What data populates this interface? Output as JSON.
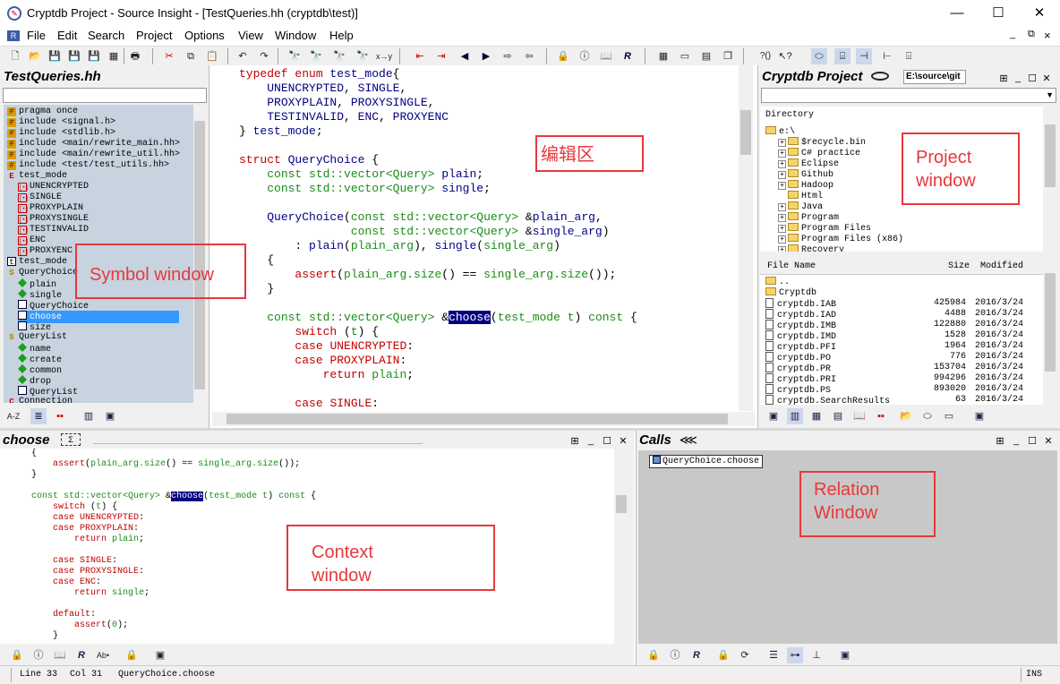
{
  "window": {
    "title": "Cryptdb Project - Source Insight - [TestQueries.hh (cryptdb\\test)]",
    "app_icon": "source-insight-icon",
    "minimize": "—",
    "maximize": "☐",
    "close": "✕"
  },
  "menu": [
    "File",
    "Edit",
    "Search",
    "Project",
    "Options",
    "View",
    "Window",
    "Help"
  ],
  "mdi_controls": [
    "_",
    "⧉",
    "×"
  ],
  "symbol_window": {
    "title": "TestQueries.hh",
    "items": [
      {
        "icon": "include-icon",
        "text": "pragma once"
      },
      {
        "icon": "include-icon",
        "text": "include <signal.h>"
      },
      {
        "icon": "include-icon",
        "text": "include <stdlib.h>"
      },
      {
        "icon": "include-icon",
        "text": "include <main/rewrite_main.hh>"
      },
      {
        "icon": "include-icon",
        "text": "include <main/rewrite_util.hh>"
      },
      {
        "icon": "include-icon",
        "text": "include <test/test_utils.hh>"
      },
      {
        "icon": "enum-icon",
        "text": "test_mode"
      },
      {
        "icon": "constant-icon",
        "text": "UNENCRYPTED"
      },
      {
        "icon": "constant-icon",
        "text": "SINGLE"
      },
      {
        "icon": "constant-icon",
        "text": "PROXYPLAIN"
      },
      {
        "icon": "constant-icon",
        "text": "PROXYSINGLE"
      },
      {
        "icon": "constant-icon",
        "text": "TESTINVALID"
      },
      {
        "icon": "constant-icon",
        "text": "ENC"
      },
      {
        "icon": "constant-icon",
        "text": "PROXYENC"
      },
      {
        "icon": "typedef-icon",
        "text": "test_mode"
      },
      {
        "icon": "struct-icon",
        "text": "QueryChoice"
      },
      {
        "icon": "field-icon",
        "text": "plain"
      },
      {
        "icon": "field-icon",
        "text": "single"
      },
      {
        "icon": "function-icon",
        "text": "QueryChoice"
      },
      {
        "icon": "function-icon",
        "text": "choose"
      },
      {
        "icon": "function-icon",
        "text": "size"
      },
      {
        "icon": "struct-icon",
        "text": "QueryList"
      },
      {
        "icon": "field-icon",
        "text": "name"
      },
      {
        "icon": "field-icon",
        "text": "create"
      },
      {
        "icon": "field-icon",
        "text": "common"
      },
      {
        "icon": "field-icon",
        "text": "drop"
      },
      {
        "icon": "function-icon",
        "text": "QueryList"
      },
      {
        "icon": "class-icon",
        "text": "Connection"
      }
    ],
    "selected_index": 19,
    "bottom_buttons": [
      "A-Z",
      "≣",
      "▪▪",
      "▥",
      "▣"
    ]
  },
  "editor": {
    "lines": [
      [
        [
          "kw",
          "typedef enum "
        ],
        [
          "id",
          "test_mode"
        ],
        [
          "",
          "{"
        ]
      ],
      [
        [
          "",
          "    "
        ],
        [
          "id",
          "UNENCRYPTED"
        ],
        [
          "",
          ", "
        ],
        [
          "id",
          "SINGLE"
        ],
        [
          "",
          ","
        ]
      ],
      [
        [
          "",
          "    "
        ],
        [
          "id",
          "PROXYPLAIN"
        ],
        [
          "",
          ", "
        ],
        [
          "id",
          "PROXYSINGLE"
        ],
        [
          "",
          ","
        ]
      ],
      [
        [
          "",
          "    "
        ],
        [
          "id",
          "TESTINVALID"
        ],
        [
          "",
          ", "
        ],
        [
          "id",
          "ENC"
        ],
        [
          "",
          ", "
        ],
        [
          "id",
          "PROXYENC"
        ]
      ],
      [
        [
          "",
          "} "
        ],
        [
          "id",
          "test_mode"
        ],
        [
          "",
          ";"
        ]
      ],
      [
        [
          "",
          ""
        ]
      ],
      [
        [
          "kw",
          "struct "
        ],
        [
          "id",
          "QueryChoice "
        ],
        [
          "",
          "{"
        ]
      ],
      [
        [
          "",
          "    "
        ],
        [
          "ty",
          "const std::vector<Query> "
        ],
        [
          "id",
          "plain"
        ],
        [
          "",
          ";"
        ]
      ],
      [
        [
          "",
          "    "
        ],
        [
          "ty",
          "const std::vector<Query> "
        ],
        [
          "id",
          "single"
        ],
        [
          "",
          ";"
        ]
      ],
      [
        [
          "",
          ""
        ]
      ],
      [
        [
          "",
          "    "
        ],
        [
          "id",
          "QueryChoice"
        ],
        [
          "",
          "("
        ],
        [
          "ty",
          "const std::vector<Query> "
        ],
        [
          "",
          "&"
        ],
        [
          "id",
          "plain_arg"
        ],
        [
          "",
          ","
        ]
      ],
      [
        [
          "",
          "                "
        ],
        [
          "ty",
          "const std::vector<Query> "
        ],
        [
          "",
          "&"
        ],
        [
          "id",
          "single_arg"
        ],
        [
          "",
          ")"
        ]
      ],
      [
        [
          "",
          "        : "
        ],
        [
          "id",
          "plain"
        ],
        [
          "",
          "("
        ],
        [
          "ty",
          "plain_arg"
        ],
        [
          "",
          "), "
        ],
        [
          "id",
          "single"
        ],
        [
          "",
          "("
        ],
        [
          "ty",
          "single_arg"
        ],
        [
          "",
          ")"
        ]
      ],
      [
        [
          "",
          "    {"
        ]
      ],
      [
        [
          "",
          "        "
        ],
        [
          "kw",
          "assert"
        ],
        [
          "",
          "("
        ],
        [
          "ty",
          "plain_arg.size"
        ],
        [
          "",
          "() == "
        ],
        [
          "ty",
          "single_arg.size"
        ],
        [
          "",
          "());"
        ]
      ],
      [
        [
          "",
          "    }"
        ]
      ],
      [
        [
          "",
          ""
        ]
      ],
      [
        [
          "",
          "    "
        ],
        [
          "ty",
          "const std::vector<Query> "
        ],
        [
          "",
          "&"
        ],
        [
          "hl",
          "choose"
        ],
        [
          "",
          "("
        ],
        [
          "ty",
          "test_mode t"
        ],
        [
          "",
          ") "
        ],
        [
          "ty",
          "const "
        ],
        [
          "",
          "{"
        ]
      ],
      [
        [
          "",
          "        "
        ],
        [
          "kw",
          "switch "
        ],
        [
          "",
          "("
        ],
        [
          "ty",
          "t"
        ],
        [
          "",
          ") {"
        ]
      ],
      [
        [
          "",
          "        "
        ],
        [
          "kw",
          "case "
        ],
        [
          "kw",
          "UNENCRYPTED"
        ],
        [
          "",
          ":"
        ]
      ],
      [
        [
          "",
          "        "
        ],
        [
          "kw",
          "case "
        ],
        [
          "kw",
          "PROXYPLAIN"
        ],
        [
          "",
          ":"
        ]
      ],
      [
        [
          "",
          "            "
        ],
        [
          "kw",
          "return "
        ],
        [
          "ty",
          "plain"
        ],
        [
          "",
          ";"
        ]
      ],
      [
        [
          "",
          ""
        ]
      ],
      [
        [
          "",
          "        "
        ],
        [
          "kw",
          "case "
        ],
        [
          "kw",
          "SINGLE"
        ],
        [
          "",
          ":"
        ]
      ]
    ]
  },
  "project_window": {
    "title": "Cryptdb Project",
    "path": "E:\\source\\git",
    "directory_label": "Directory",
    "root": "e:\\",
    "folders": [
      "$recycle.bin",
      "C# practice",
      "Eclipse",
      "Github",
      "Hadoop",
      "Html",
      "Java",
      "Program",
      "Program Files",
      "Program Files (x86)",
      "Recovery"
    ],
    "file_headers": {
      "name": "File Name",
      "size": "Size",
      "modified": "Modified"
    },
    "files": [
      {
        "name": "..",
        "size": "",
        "modified": "",
        "kind": "folder"
      },
      {
        "name": "Cryptdb",
        "size": "",
        "modified": "",
        "kind": "folder"
      },
      {
        "name": "cryptdb.IAB",
        "size": "425984",
        "modified": "2016/3/24",
        "kind": "file"
      },
      {
        "name": "cryptdb.IAD",
        "size": "4488",
        "modified": "2016/3/24",
        "kind": "file"
      },
      {
        "name": "cryptdb.IMB",
        "size": "122880",
        "modified": "2016/3/24",
        "kind": "file"
      },
      {
        "name": "cryptdb.IMD",
        "size": "1528",
        "modified": "2016/3/24",
        "kind": "file"
      },
      {
        "name": "cryptdb.PFI",
        "size": "1964",
        "modified": "2016/3/24",
        "kind": "file"
      },
      {
        "name": "cryptdb.PO",
        "size": "776",
        "modified": "2016/3/24",
        "kind": "file"
      },
      {
        "name": "cryptdb.PR",
        "size": "153704",
        "modified": "2016/3/24",
        "kind": "file"
      },
      {
        "name": "cryptdb.PRI",
        "size": "994296",
        "modified": "2016/3/24",
        "kind": "file"
      },
      {
        "name": "cryptdb.PS",
        "size": "893020",
        "modified": "2016/3/24",
        "kind": "file"
      },
      {
        "name": "cryptdb.SearchResults",
        "size": "63",
        "modified": "2016/3/24",
        "kind": "file"
      }
    ]
  },
  "context_window": {
    "title": "choose",
    "lines": [
      [
        [
          "",
          "{"
        ]
      ],
      [
        [
          "",
          "    "
        ],
        [
          "kw",
          "assert"
        ],
        [
          "",
          "("
        ],
        [
          "ty",
          "plain_arg.size"
        ],
        [
          "",
          "() == "
        ],
        [
          "ty",
          "single_arg.size"
        ],
        [
          "",
          "());"
        ]
      ],
      [
        [
          "",
          "}"
        ]
      ],
      [
        [
          "",
          ""
        ]
      ],
      [
        [
          "ty",
          "const std::vector<Query> "
        ],
        [
          "",
          "&"
        ],
        [
          "hl",
          "choose"
        ],
        [
          "",
          "("
        ],
        [
          "ty",
          "test_mode t"
        ],
        [
          "",
          ") "
        ],
        [
          "ty",
          "const "
        ],
        [
          "",
          "{"
        ]
      ],
      [
        [
          "",
          "    "
        ],
        [
          "kw",
          "switch "
        ],
        [
          "",
          "("
        ],
        [
          "ty",
          "t"
        ],
        [
          "",
          ") {"
        ]
      ],
      [
        [
          "",
          "    "
        ],
        [
          "kw",
          "case UNENCRYPTED"
        ],
        [
          "",
          ":"
        ]
      ],
      [
        [
          "",
          "    "
        ],
        [
          "kw",
          "case PROXYPLAIN"
        ],
        [
          "",
          ":"
        ]
      ],
      [
        [
          "",
          "        "
        ],
        [
          "kw",
          "return "
        ],
        [
          "ty",
          "plain"
        ],
        [
          "",
          ";"
        ]
      ],
      [
        [
          "",
          ""
        ]
      ],
      [
        [
          "",
          "    "
        ],
        [
          "kw",
          "case SINGLE"
        ],
        [
          "",
          ":"
        ]
      ],
      [
        [
          "",
          "    "
        ],
        [
          "kw",
          "case PROXYSINGLE"
        ],
        [
          "",
          ":"
        ]
      ],
      [
        [
          "",
          "    "
        ],
        [
          "kw",
          "case ENC"
        ],
        [
          "",
          ":"
        ]
      ],
      [
        [
          "",
          "        "
        ],
        [
          "kw",
          "return "
        ],
        [
          "ty",
          "single"
        ],
        [
          "",
          ";"
        ]
      ],
      [
        [
          "",
          ""
        ]
      ],
      [
        [
          "",
          "    "
        ],
        [
          "kw",
          "default"
        ],
        [
          "",
          ":"
        ]
      ],
      [
        [
          "",
          "        "
        ],
        [
          "kw",
          "assert"
        ],
        [
          "",
          "("
        ],
        [
          "ty",
          "0"
        ],
        [
          "",
          ");"
        ]
      ],
      [
        [
          "",
          "    }"
        ]
      ]
    ]
  },
  "relation_window": {
    "title": "Calls",
    "node": "QueryChoice.choose"
  },
  "annotations": {
    "editor": "编辑区",
    "symbol": "Symbol window",
    "project": [
      "Project",
      "window"
    ],
    "context": [
      "Context",
      "window"
    ],
    "relation": [
      "Relation",
      "Window"
    ]
  },
  "status": {
    "line": "Line 33",
    "col": "Col 31",
    "symbol": "QueryChoice.choose",
    "mode": "INS"
  }
}
